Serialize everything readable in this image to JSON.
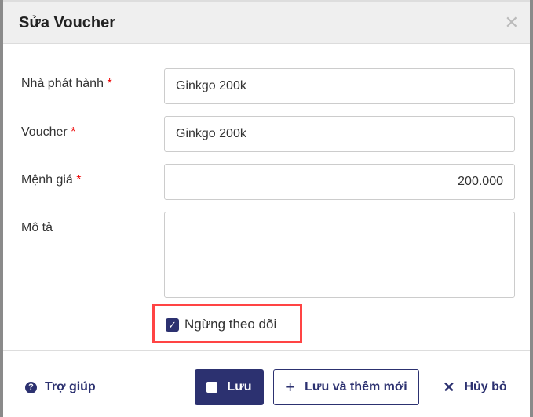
{
  "dialog": {
    "title": "Sửa Voucher"
  },
  "fields": [
    {
      "label": "Nhà phát hành",
      "required": "*",
      "value": "Ginkgo 200k"
    },
    {
      "label": "Voucher",
      "required": "*",
      "value": "Ginkgo 200k"
    },
    {
      "label": "Mệnh giá",
      "required": "*",
      "value": "200.000"
    },
    {
      "label": "Mô tả",
      "value": ""
    }
  ],
  "checkbox": {
    "label": "Ngừng theo dõi",
    "checked": true
  },
  "footer": {
    "help": "Trợ giúp",
    "save": "Lưu",
    "save_new": "Lưu và thêm mới",
    "cancel": "Hủy bỏ"
  },
  "colors": {
    "primary": "#2c3170",
    "highlight": "#ff4444",
    "required": "#e00000"
  }
}
